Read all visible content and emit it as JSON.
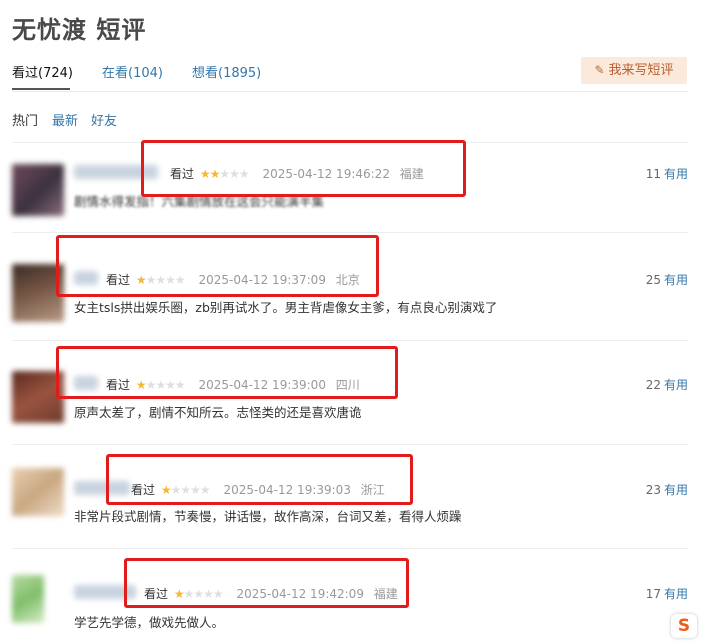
{
  "page": {
    "title": "无忧渡 短评"
  },
  "tabs": [
    {
      "label": "看过(724)",
      "active": true
    },
    {
      "label": "在看(104)",
      "active": false
    },
    {
      "label": "想看(1895)",
      "active": false
    }
  ],
  "write_button": {
    "label": "我来写短评"
  },
  "sorts": [
    {
      "label": "热门",
      "active": true
    },
    {
      "label": "最新",
      "active": false
    },
    {
      "label": "好友",
      "active": false
    }
  ],
  "comments": [
    {
      "status": "看过",
      "rating": 2,
      "max_rating": 5,
      "time": "2025-04-12 19:46:22",
      "location": "福建",
      "useful_count": "11",
      "useful_label": "有用",
      "text": "剧情水得发指！六集剧情放在这会只能演半集"
    },
    {
      "status": "看过",
      "rating": 1,
      "max_rating": 5,
      "time": "2025-04-12 19:37:09",
      "location": "北京",
      "useful_count": "25",
      "useful_label": "有用",
      "text": "女主tsls拱出娱乐圈，zb别再试水了。男主背虐像女主爹，有点良心别演戏了"
    },
    {
      "status": "看过",
      "rating": 1,
      "max_rating": 5,
      "time": "2025-04-12 19:39:00",
      "location": "四川",
      "useful_count": "22",
      "useful_label": "有用",
      "text": "原声太差了，剧情不知所云。志怪类的还是喜欢唐诡"
    },
    {
      "status": "看过",
      "rating": 1,
      "max_rating": 5,
      "time": "2025-04-12 19:39:03",
      "location": "浙江",
      "useful_count": "23",
      "useful_label": "有用",
      "text": "非常片段式剧情，节奏慢，讲话慢，故作高深，台词又差，看得人烦躁"
    },
    {
      "status": "看过",
      "rating": 1,
      "max_rating": 5,
      "time": "2025-04-12 19:42:09",
      "location": "福建",
      "useful_count": "17",
      "useful_label": "有用",
      "text": "学艺先学德，做戏先做人。"
    }
  ],
  "colors": {
    "link": "#3377aa",
    "star_on": "#f7b731",
    "star_off": "#dfdfdf",
    "highlight_box": "#e21b1b",
    "write_button_bg": "#fbe9dc"
  },
  "icons": {
    "write_button": "pencil-icon",
    "corner_badge": "sogou-s-icon"
  },
  "badge": {
    "label": "S"
  }
}
